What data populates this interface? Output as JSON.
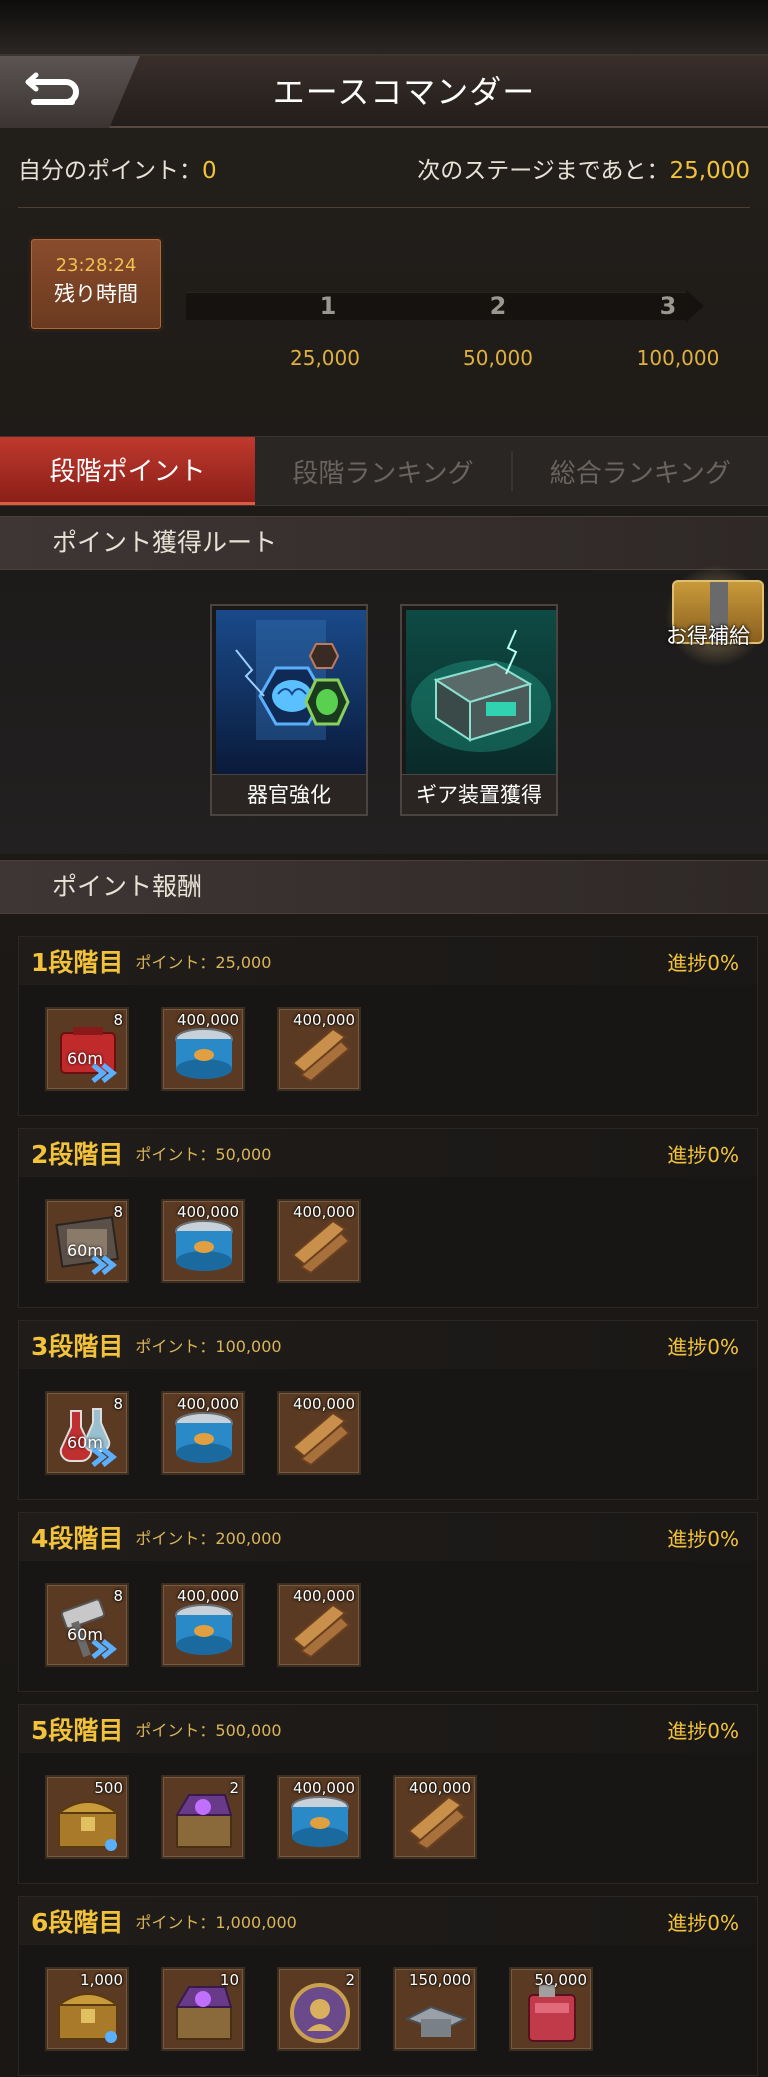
{
  "header": {
    "title": "エースコマンダー"
  },
  "points": {
    "my_label": "自分のポイント：",
    "my_value": "0",
    "next_label": "次のステージまであと：",
    "next_value": "25,000"
  },
  "timer": {
    "time": "23:28:24",
    "label": "残り時間"
  },
  "stages": [
    {
      "num": "1",
      "value": "25,000"
    },
    {
      "num": "2",
      "value": "50,000"
    },
    {
      "num": "3",
      "value": "100,000"
    }
  ],
  "tabs": [
    "段階ポイント",
    "段階ランキング",
    "総合ランキング"
  ],
  "routes_header": "ポイント獲得ルート",
  "routes": [
    {
      "label": "器官強化",
      "icon": "brain-organ-icon"
    },
    {
      "label": "ギア装置獲得",
      "icon": "gear-crate-icon"
    }
  ],
  "gift": {
    "label": "お得補給"
  },
  "rewards_header": "ポイント報酬",
  "tiers": [
    {
      "name": "1段階目",
      "points": "ポイント：25,000",
      "progress": "進捗0%",
      "items": [
        {
          "icon": "red-speedup-icon",
          "count": "8",
          "time": "60m"
        },
        {
          "icon": "food-can-icon",
          "count": "400,000"
        },
        {
          "icon": "wood-planks-icon",
          "count": "400,000"
        }
      ]
    },
    {
      "name": "2段階目",
      "points": "ポイント：50,000",
      "progress": "進捗0%",
      "items": [
        {
          "icon": "book-speedup-icon",
          "count": "8",
          "time": "60m"
        },
        {
          "icon": "food-can-icon",
          "count": "400,000"
        },
        {
          "icon": "wood-planks-icon",
          "count": "400,000"
        }
      ]
    },
    {
      "name": "3段階目",
      "points": "ポイント：100,000",
      "progress": "進捗0%",
      "items": [
        {
          "icon": "flask-speedup-icon",
          "count": "8",
          "time": "60m"
        },
        {
          "icon": "food-can-icon",
          "count": "400,000"
        },
        {
          "icon": "wood-planks-icon",
          "count": "400,000"
        }
      ]
    },
    {
      "name": "4段階目",
      "points": "ポイント：200,000",
      "progress": "進捗0%",
      "items": [
        {
          "icon": "hammer-speedup-icon",
          "count": "8",
          "time": "60m"
        },
        {
          "icon": "food-can-icon",
          "count": "400,000"
        },
        {
          "icon": "wood-planks-icon",
          "count": "400,000"
        }
      ]
    },
    {
      "name": "5段階目",
      "points": "ポイント：500,000",
      "progress": "進捗0%",
      "items": [
        {
          "icon": "gold-chest-icon",
          "count": "500"
        },
        {
          "icon": "purple-chest-icon",
          "count": "2"
        },
        {
          "icon": "food-can-icon",
          "count": "400,000"
        },
        {
          "icon": "wood-planks-icon",
          "count": "400,000"
        }
      ]
    },
    {
      "name": "6段階目",
      "points": "ポイント：1,000,000",
      "progress": "進捗0%",
      "items": [
        {
          "icon": "gold-chest-icon",
          "count": "1,000"
        },
        {
          "icon": "purple-chest-icon",
          "count": "10"
        },
        {
          "icon": "medal-icon",
          "count": "2"
        },
        {
          "icon": "steel-icon",
          "count": "150,000"
        },
        {
          "icon": "fuel-can-icon",
          "count": "50,000"
        }
      ]
    }
  ]
}
